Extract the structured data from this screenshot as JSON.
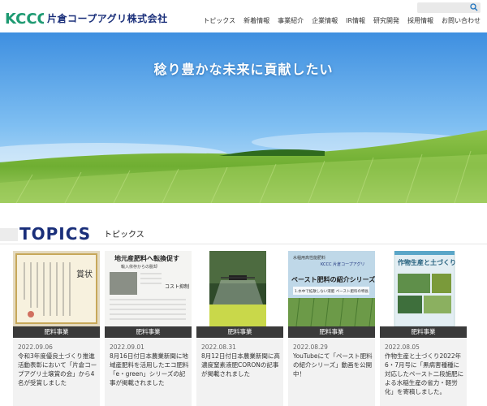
{
  "brand": {
    "name": "片倉コープアグリ株式会社",
    "logo_letters": "KCCC"
  },
  "nav": {
    "items": [
      "トピックス",
      "新着情報",
      "事業紹介",
      "企業情報",
      "IR情報",
      "研究開発",
      "採用情報",
      "お問い合わせ"
    ]
  },
  "search": {
    "placeholder": ""
  },
  "hero": {
    "title": "稔り豊かな未来に貢献したい"
  },
  "topics": {
    "title": "TOPICS",
    "subtitle": "トピックス"
  },
  "cards": [
    {
      "tag": "肥料事業",
      "date": "2022.09.06",
      "text": "令和3年度優良土づくり推進活動表彰において「片倉コープアグリ土壌賞の会」から4名が受賞しました",
      "image": "certificate"
    },
    {
      "tag": "肥料事業",
      "date": "2022.09.01",
      "text": "8月16日付日本農業新聞に地域産肥料を活用したエコ肥料「e・green」シリーズの記事が掲載されました",
      "image": "newspaper"
    },
    {
      "tag": "肥料事業",
      "date": "2022.08.31",
      "text": "8月12日付日本農業新聞に高濃度窒素液肥CORONの記事が掲載されました",
      "image": "drone"
    },
    {
      "tag": "肥料事業",
      "date": "2022.08.29",
      "text": "YouTubeにて「ペースト肥料の紹介シリーズ」動画を公開中！",
      "image": "paste"
    },
    {
      "tag": "肥料事業",
      "date": "2022.08.05",
      "text": "作物生産と土づくり2022年6・7月号に「黒病害種種に対応したペースト二段施肥による水稲生産の省力・軽労化」を寄稿しました。",
      "image": "magazine"
    }
  ],
  "card_images": {
    "paste_title": "ペースト肥料の紹介シリーズ",
    "paste_header": "水稲用高性能肥料",
    "paste_brand": "KCCC 片倉コープアグリ",
    "paste_sub": "1.水中で拡散しない液肥 ペースト肥料の特長",
    "magazine_title": "作物生産と土づくり",
    "newspaper_headline": "地元産肥料へ転換促す",
    "newspaper_sub": "輸入依存からの脱却",
    "newspaper_side": "コスト抑制",
    "certificate_title": "賞状"
  },
  "colors": {
    "brand": "#1a2f7a",
    "card_tag_bg": "#3a3a3a",
    "card_bg": "#f2f2f2"
  }
}
